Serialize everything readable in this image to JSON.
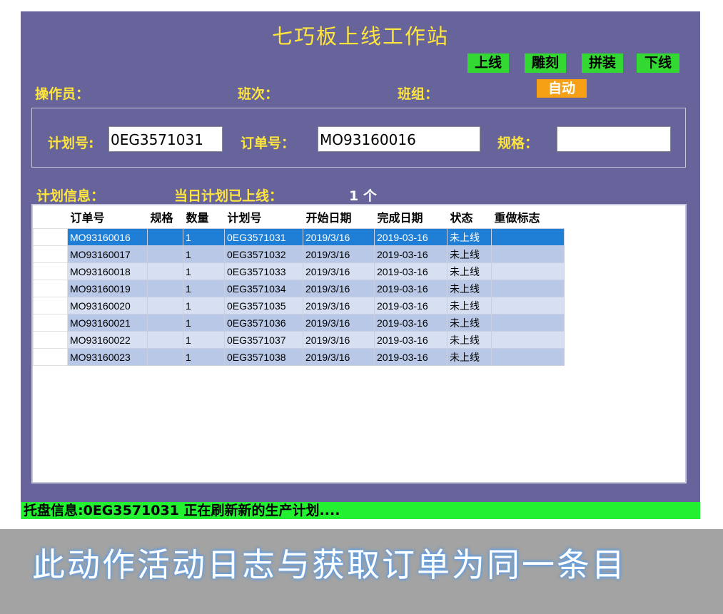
{
  "window": {
    "title": "七巧板上线工作站",
    "modes": [
      "上线",
      "雕刻",
      "拼装",
      "下线"
    ],
    "auto_label": "自动",
    "operator_label": "操作员：",
    "shift_label": "班次：",
    "team_label": "班组："
  },
  "fields": {
    "plan_label": "计划号:",
    "plan_value": "0EG3571031",
    "order_label": "订单号：",
    "order_value": "MO93160016",
    "spec_label": "规格：",
    "spec_value": ""
  },
  "plan_info": {
    "label": "计划信息：",
    "today_label": "当日计划已上线：",
    "count": "1 个"
  },
  "table": {
    "columns": [
      "订单号",
      "规格",
      "数量",
      "计划号",
      "开始日期",
      "完成日期",
      "状态",
      "重做标志"
    ],
    "selected_row": 0,
    "rows": [
      [
        "MO93160016",
        "",
        "1",
        "0EG3571031",
        "2019/3/16",
        "2019-03-16",
        "未上线",
        ""
      ],
      [
        "MO93160017",
        "",
        "1",
        "0EG3571032",
        "2019/3/16",
        "2019-03-16",
        "未上线",
        ""
      ],
      [
        "MO93160018",
        "",
        "1",
        "0EG3571033",
        "2019/3/16",
        "2019-03-16",
        "未上线",
        ""
      ],
      [
        "MO93160019",
        "",
        "1",
        "0EG3571034",
        "2019/3/16",
        "2019-03-16",
        "未上线",
        ""
      ],
      [
        "MO93160020",
        "",
        "1",
        "0EG3571035",
        "2019/3/16",
        "2019-03-16",
        "未上线",
        ""
      ],
      [
        "MO93160021",
        "",
        "1",
        "0EG3571036",
        "2019/3/16",
        "2019-03-16",
        "未上线",
        ""
      ],
      [
        "MO93160022",
        "",
        "1",
        "0EG3571037",
        "2019/3/16",
        "2019-03-16",
        "未上线",
        ""
      ],
      [
        "MO93160023",
        "",
        "1",
        "0EG3571038",
        "2019/3/16",
        "2019-03-16",
        "未上线",
        ""
      ]
    ]
  },
  "status_bar": {
    "text": "托盘信息:0EG3571031   正在刷新新的生产计划...."
  },
  "caption": {
    "text": "此动作活动日志与获取订单为同一条目"
  },
  "colors": {
    "window_bg": "#66649a",
    "label_yellow": "#ffe53d",
    "mode_green": "#33d833",
    "auto_orange": "#f5a015",
    "status_green": "#22f030",
    "selected_blue": "#1f7fd6"
  }
}
